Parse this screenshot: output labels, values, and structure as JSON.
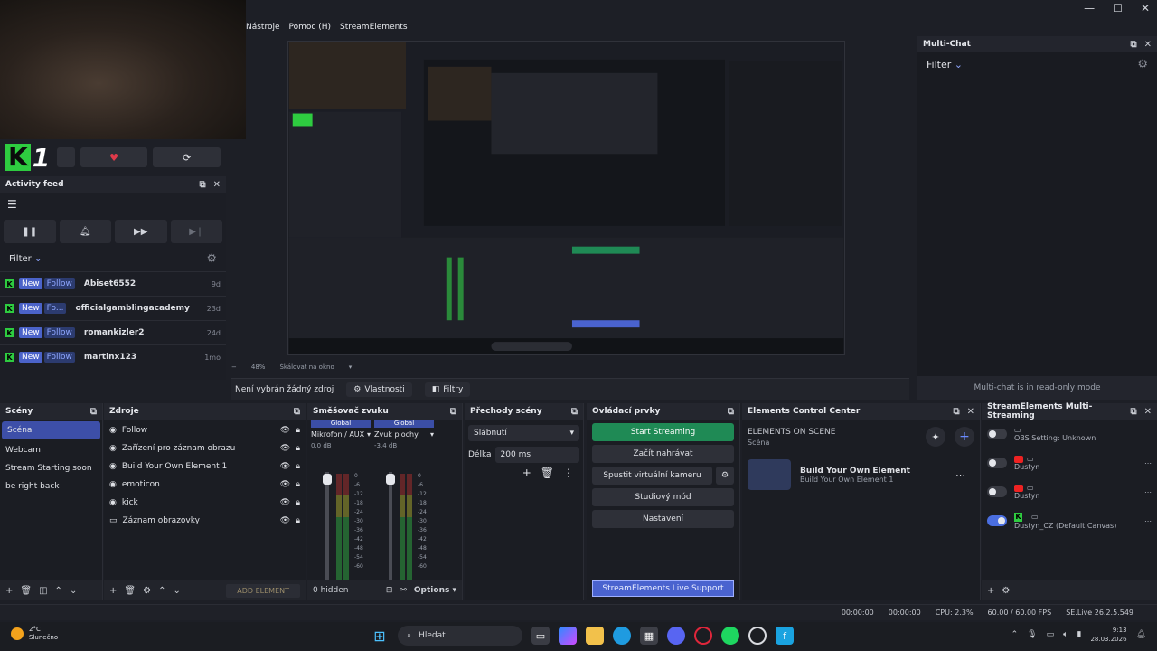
{
  "menu": [
    "Nástroje",
    "Pomoc (H)",
    "StreamElements"
  ],
  "logo": {
    "k": "K",
    "one": "1"
  },
  "activity": {
    "title": "Activity feed",
    "filter": "Filter",
    "items": [
      {
        "badge1": "New",
        "badge2": "Follow",
        "name": "Abiset6552",
        "time": "9d"
      },
      {
        "badge1": "New",
        "badge2": "Fo...",
        "name": "officialgamblingacademy",
        "time": "23d"
      },
      {
        "badge1": "New",
        "badge2": "Follow",
        "name": "romankizler2",
        "time": "24d"
      },
      {
        "badge1": "New",
        "badge2": "Follow",
        "name": "martinx123",
        "time": "1mo"
      }
    ]
  },
  "multichat": {
    "title": "Multi-Chat",
    "filter": "Filter",
    "footer": "Multi-chat is in read-only mode"
  },
  "zoom": {
    "level": "48%",
    "mode": "Škálovat na okno"
  },
  "props": {
    "no_source": "Není vybrán žádný zdroj",
    "properties": "Vlastnosti",
    "filters": "Filtry"
  },
  "scenes": {
    "title": "Scény",
    "items": [
      "Scéna",
      "Webcam",
      "Stream Starting soon",
      "be right back"
    ]
  },
  "sources": {
    "title": "Zdroje",
    "items": [
      "Follow",
      "Zařízení pro záznam obrazu",
      "Build Your Own Element 1",
      "emoticon",
      "kick",
      "Záznam obrazovky"
    ],
    "add_element": "ADD ELEMENT"
  },
  "mixer": {
    "title": "Směšovač zvuku",
    "channels": [
      {
        "head": "Global",
        "name": "Mikrofon / AUX",
        "db": "0.0 dB"
      },
      {
        "head": "Global",
        "name": "Zvuk plochy",
        "db": "-3.4 dB"
      }
    ],
    "scale": [
      "0",
      "-6",
      "-12",
      "-18",
      "-24",
      "-30",
      "-36",
      "-42",
      "-48",
      "-54",
      "-60"
    ],
    "hidden": "0 hidden",
    "options": "Options"
  },
  "transitions": {
    "title": "Přechody scény",
    "type": "Slábnutí",
    "duration_label": "Délka",
    "duration": "200 ms"
  },
  "controls": {
    "title": "Ovládací prvky",
    "start_streaming": "Start Streaming",
    "record": "Začít nahrávat",
    "virtual_cam": "Spustit virtuální kameru",
    "studio": "Studiový mód",
    "settings": "Nastavení",
    "support": "StreamElements Live Support"
  },
  "ecc": {
    "title": "Elements Control Center",
    "heading": "ELEMENTS ON SCENE",
    "scene": "Scéna",
    "element_title": "Build Your Own Element",
    "element_sub": "Build Your Own Element 1"
  },
  "ms": {
    "title": "StreamElements Multi-Streaming",
    "items": [
      {
        "label": "OBS Setting: Unknown",
        "on": false,
        "yt": false
      },
      {
        "label": "Dustyn",
        "on": false,
        "yt": true
      },
      {
        "label": "Dustyn",
        "on": false,
        "yt": true
      },
      {
        "label": "Dustyn_CZ (Default Canvas)",
        "on": true,
        "yt": false
      }
    ]
  },
  "status": {
    "t1": "00:00:00",
    "t2": "00:00:00",
    "cpu": "CPU: 2.3%",
    "fps": "60.00 / 60.00 FPS",
    "version": "SE.Live 26.2.5.549"
  },
  "taskbar": {
    "temp": "2°C",
    "weather": "Slunečno",
    "search": "Hledat",
    "time": "9:13",
    "date": "28.03.2026"
  }
}
